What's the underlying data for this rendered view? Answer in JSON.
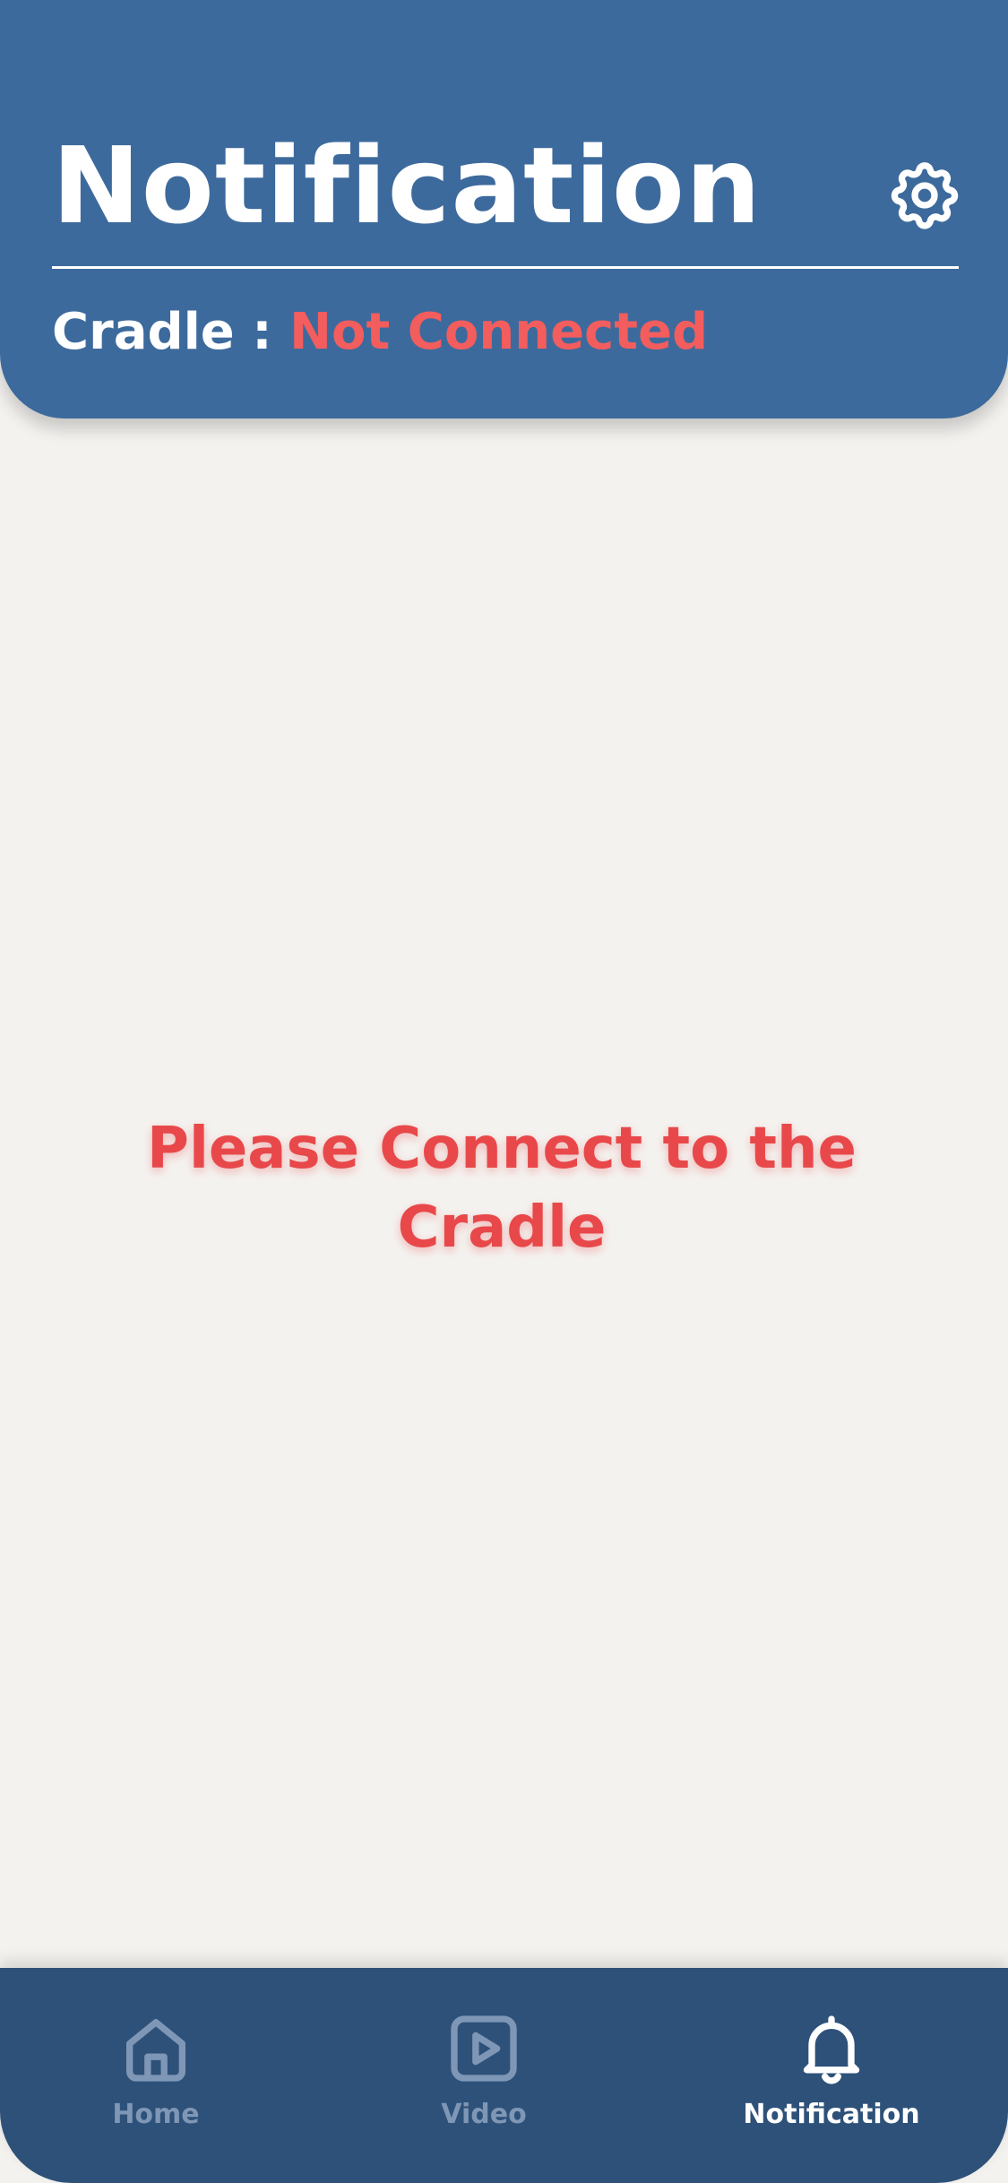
{
  "header": {
    "title": "Notification",
    "settings_icon": "gear-icon",
    "status_label": "Cradle : ",
    "status_value": "Not Connected"
  },
  "main": {
    "empty_message": "Please Connect to the Cradle"
  },
  "bottom_nav": {
    "items": [
      {
        "label": "Home",
        "icon": "home-icon",
        "active": false
      },
      {
        "label": "Video",
        "icon": "play-icon",
        "active": false
      },
      {
        "label": "Notification",
        "icon": "bell-icon",
        "active": true
      }
    ]
  },
  "colors": {
    "header_bg": "#3d6a9c",
    "nav_bg": "#2e5179",
    "page_bg": "#f4f2ef",
    "status_error": "#f35d5d",
    "message_error": "#e8484a",
    "nav_inactive": "#7f97b6",
    "nav_active": "#ffffff"
  }
}
